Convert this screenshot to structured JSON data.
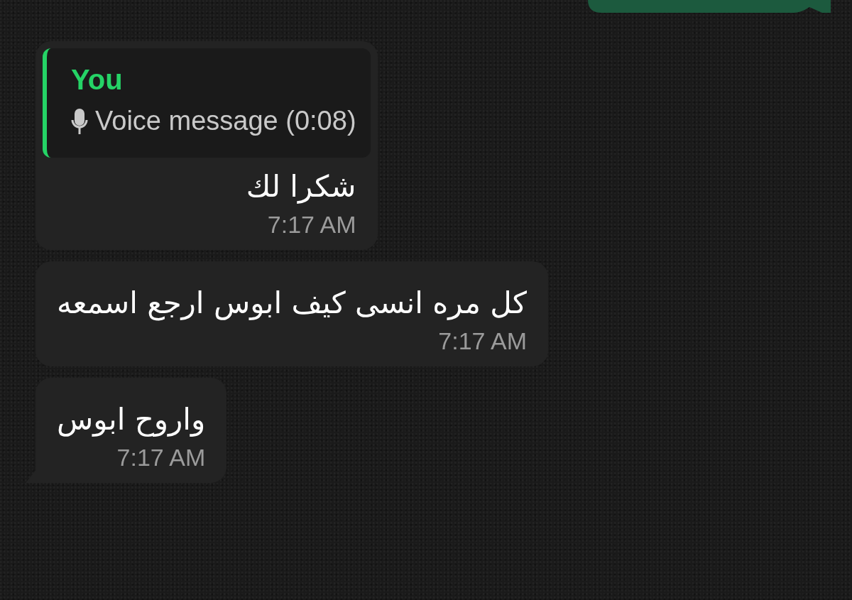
{
  "messages": [
    {
      "kind": "outgoing_partial"
    },
    {
      "kind": "incoming",
      "tail": false,
      "quote": {
        "author": "You",
        "text": "Voice message (0:08)",
        "kind": "voice"
      },
      "text": "شكرا لك",
      "time": "7:17 AM"
    },
    {
      "kind": "incoming",
      "tail": false,
      "text": "كل مره انسى كيف ابوس ارجع اسمعه",
      "time": "7:17 AM"
    },
    {
      "kind": "incoming",
      "tail": true,
      "text": "واروح ابوس",
      "time": "7:17 AM"
    }
  ]
}
